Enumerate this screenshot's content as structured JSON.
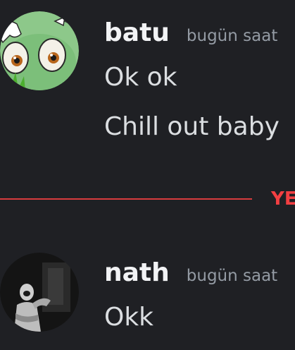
{
  "messages": [
    {
      "username": "batu",
      "timestamp": "bugün saat",
      "avatar_icon": "cartoon-frog-avatar",
      "lines": [
        "Ok ok",
        "Chill out baby"
      ]
    },
    {
      "username": "nath",
      "timestamp": "bugün saat",
      "avatar_icon": "dark-photo-avatar",
      "lines": [
        "Okk"
      ]
    }
  ],
  "divider": {
    "label": "YE",
    "color": "#f23f42"
  }
}
